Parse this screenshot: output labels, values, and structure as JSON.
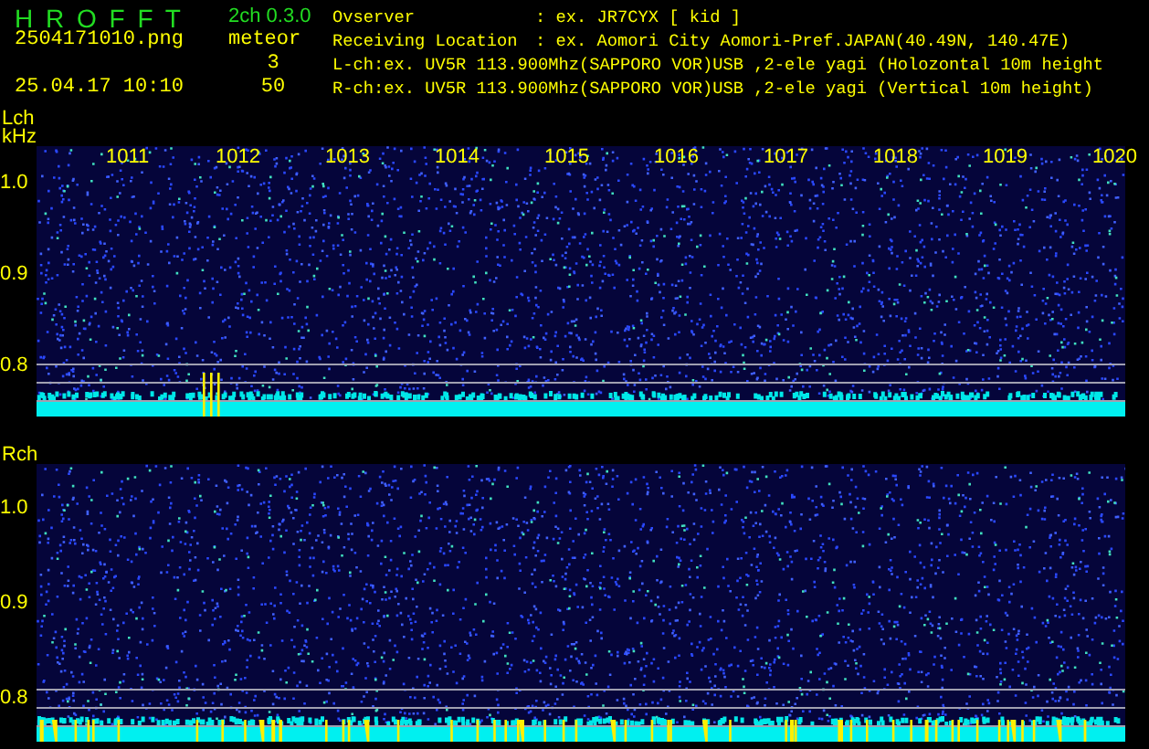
{
  "header": {
    "title": "H R O F F T",
    "version": "2ch 0.3.0",
    "file_name": "2504171010.png",
    "datetime": "25.04.17 10:10",
    "mode": "meteor",
    "counts": [
      "3",
      "50"
    ],
    "info": [
      {
        "kind": "field",
        "label": "Ovserver",
        "value": ": ex. JR7CYX [ kid ]"
      },
      {
        "kind": "field",
        "label": "Receiving Location",
        "value": ": ex. Aomori City Aomori-Pref.JAPAN(40.49N, 140.47E)"
      },
      {
        "kind": "line",
        "text": "L-ch:ex. UV5R 113.900Mhz(SAPPORO VOR)USB ,2-ele yagi (Holozontal 10m height"
      },
      {
        "kind": "line",
        "text": "R-ch:ex. UV5R 113.900Mhz(SAPPORO VOR)USB ,2-ele yagi (Vertical 10m height)"
      }
    ]
  },
  "channels": [
    {
      "label": "Lch",
      "unit": "kHz",
      "freq_labels": [
        "1011",
        "1012",
        "1013",
        "1014",
        "1015",
        "1016",
        "1017",
        "1018",
        "1019",
        "1020"
      ],
      "ticks": [
        "1.0",
        "0.9",
        "0.8"
      ]
    },
    {
      "label": "Rch",
      "ticks": [
        "1.0",
        "0.9",
        "0.8"
      ]
    }
  ]
}
